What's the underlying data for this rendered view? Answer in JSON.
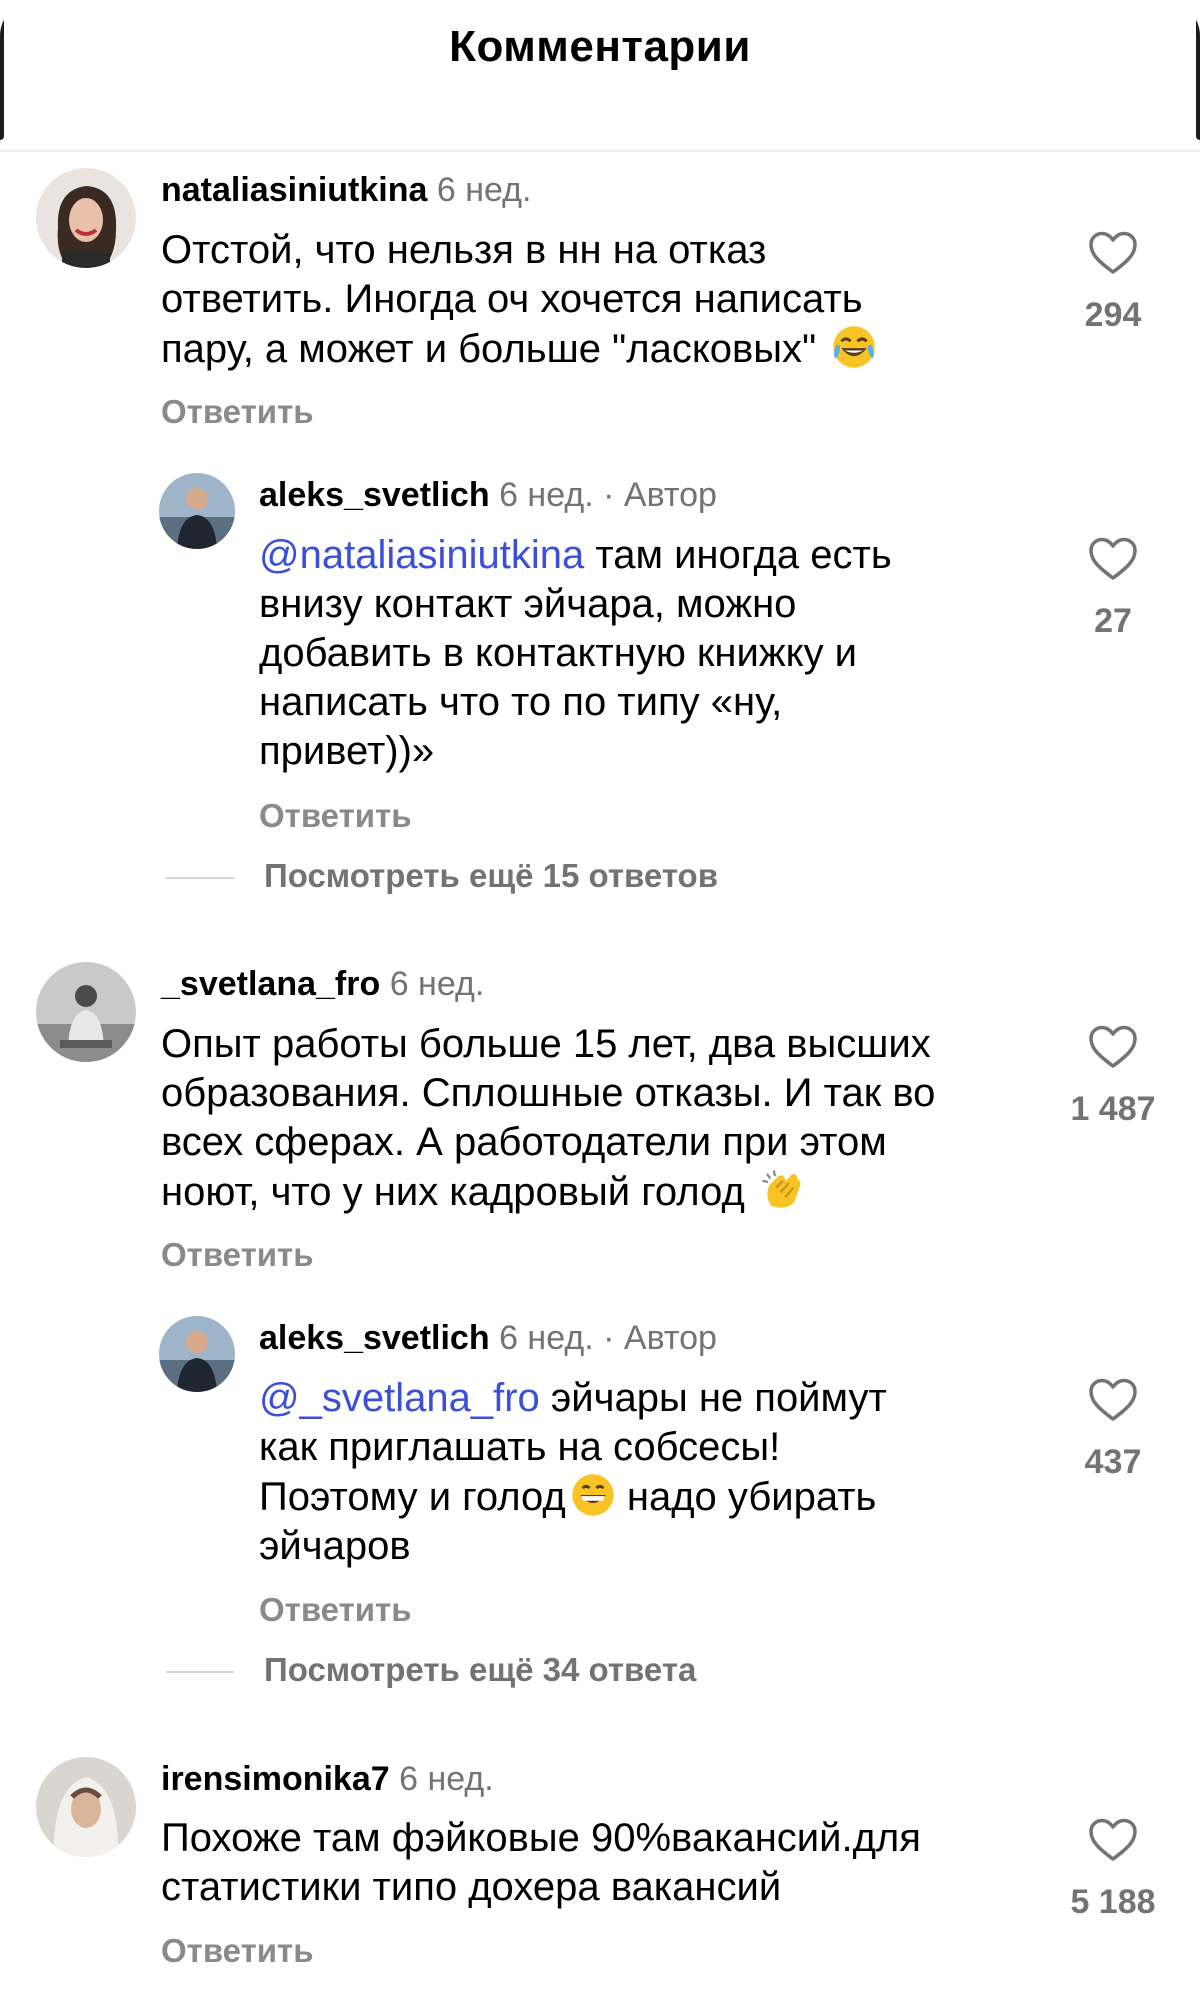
{
  "header": {
    "title": "Комментарии"
  },
  "comments": [
    {
      "username": "nataliasiniutkina",
      "time": "6 нед.",
      "lines": [
        "Отстой, что нельзя в нн на отказ",
        "ответить. Иногда оч хочется написать",
        "пару, а может и больше \"ласковых\""
      ],
      "emoji": "tears-of-joy-emoji",
      "likes": "294",
      "reply_label": "Ответить"
    },
    {
      "username": "aleks_svetlich",
      "time": "6 нед.",
      "author_tag": "· Автор",
      "mention": "@nataliasiniutkina",
      "lines": [
        " там иногда есть",
        "внизу контакт эйчара, можно",
        "добавить в контактную книжку и",
        "написать что то по типу «ну,",
        "привет))»"
      ],
      "likes": "27",
      "reply_label": "Ответить",
      "view_more": "Посмотреть ещё 15 ответов"
    },
    {
      "username": "_svetlana_fro",
      "time": "6 нед.",
      "lines": [
        "Опыт работы больше 15 лет, два высших",
        "образования. Сплошные отказы. И так во",
        "всех сферах. А работодатели при этом",
        "ноют, что у них кадровый голод"
      ],
      "emoji": "clapping-hands-emoji",
      "likes": "1 487",
      "reply_label": "Ответить"
    },
    {
      "username": "aleks_svetlich",
      "time": "6 нед.",
      "author_tag": "· Автор",
      "mention": "@_svetlana_fro",
      "lines": [
        " эйчары не поймут",
        "как приглашать на собсесы!",
        "Поэтому и голод",
        " надо убирать",
        "эйчаров"
      ],
      "emoji": "grinning-emoji",
      "likes": "437",
      "reply_label": "Ответить",
      "view_more": "Посмотреть ещё 34 ответа"
    },
    {
      "username": "irensimonika7",
      "time": "6 нед.",
      "lines": [
        "Похоже там фэйковые 90%вакансий.для",
        "статистики типо дохера вакансий"
      ],
      "likes": "5 188",
      "reply_label": "Ответить"
    }
  ],
  "colors": {
    "mention": "#3b4fd9",
    "secondary_text": "#737373",
    "reply_link": "#8a8a8a"
  }
}
